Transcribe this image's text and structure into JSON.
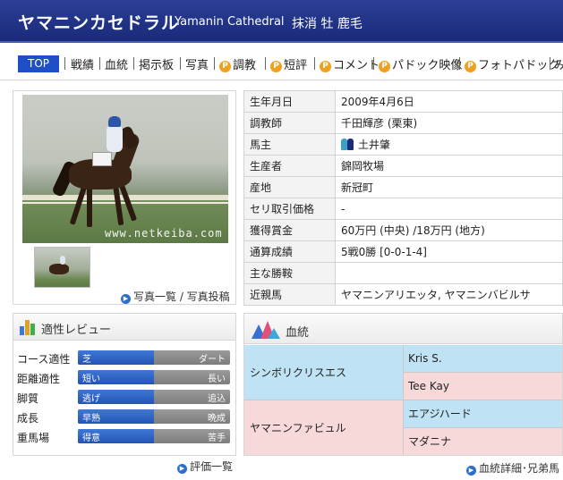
{
  "header": {
    "horse_name": "ヤマニンカセドラル",
    "english_name": "Yamanin Cathedral",
    "status": "抹消 牡 鹿毛"
  },
  "nav": {
    "top": "TOP",
    "items": [
      "戦績",
      "血統",
      "掲示板",
      "写真",
      "調教",
      "短評",
      "コメント",
      "パドック映像",
      "フォトパドック",
      "み"
    ],
    "premium_icon": "P"
  },
  "photo": {
    "watermark": "www.netkeiba.com",
    "links_label": "写真一覧 / 写真投稿"
  },
  "profile": [
    {
      "key": "生年月日",
      "value": "2009年4月6日"
    },
    {
      "key": "調教師",
      "value": "千田輝彦 (栗東)"
    },
    {
      "key": "馬主",
      "value": "土井肇"
    },
    {
      "key": "生産者",
      "value": "錦岡牧場"
    },
    {
      "key": "産地",
      "value": "新冠町"
    },
    {
      "key": "セリ取引価格",
      "value": "-"
    },
    {
      "key": "獲得賞金",
      "value": "60万円 (中央) /18万円 (地方)"
    },
    {
      "key": "通算成績",
      "value": "5戦0勝 [0-0-1-4]"
    },
    {
      "key": "主な勝鞍",
      "value": ""
    },
    {
      "key": "近親馬",
      "value": "ヤマニンアリエッタ, ヤマニンバビルサ"
    }
  ],
  "review": {
    "title": "適性レビュー",
    "rows": [
      {
        "label": "コース適性",
        "left": "芝",
        "right": "ダート",
        "level": 0.5
      },
      {
        "label": "距離適性",
        "left": "短い",
        "right": "長い",
        "level": 0.5
      },
      {
        "label": "脚質",
        "left": "逃げ",
        "right": "追込",
        "level": 0.5
      },
      {
        "label": "成長",
        "left": "早熟",
        "right": "晩成",
        "level": 0.5
      },
      {
        "label": "重馬場",
        "left": "得意",
        "right": "苦手",
        "level": 0.5
      }
    ],
    "link": "評価一覧"
  },
  "bloodline": {
    "title": "血統",
    "sire": "シンボリクリスエス",
    "sire_sire": "Kris S.",
    "sire_dam": "Tee Kay",
    "dam": "ヤマニンファビュル",
    "dam_sire": "エアジハード",
    "dam_dam": "マダニナ",
    "link": "血統詳細･兄弟馬"
  },
  "colors": {
    "header_bg": "#1b2a7a",
    "nav_top_bg": "#1e4fc7",
    "bar_fill": "#2354b4",
    "male_cell": "#bfe3f5",
    "female_cell": "#f8d9d9",
    "premium_icon": "#f0a020"
  }
}
